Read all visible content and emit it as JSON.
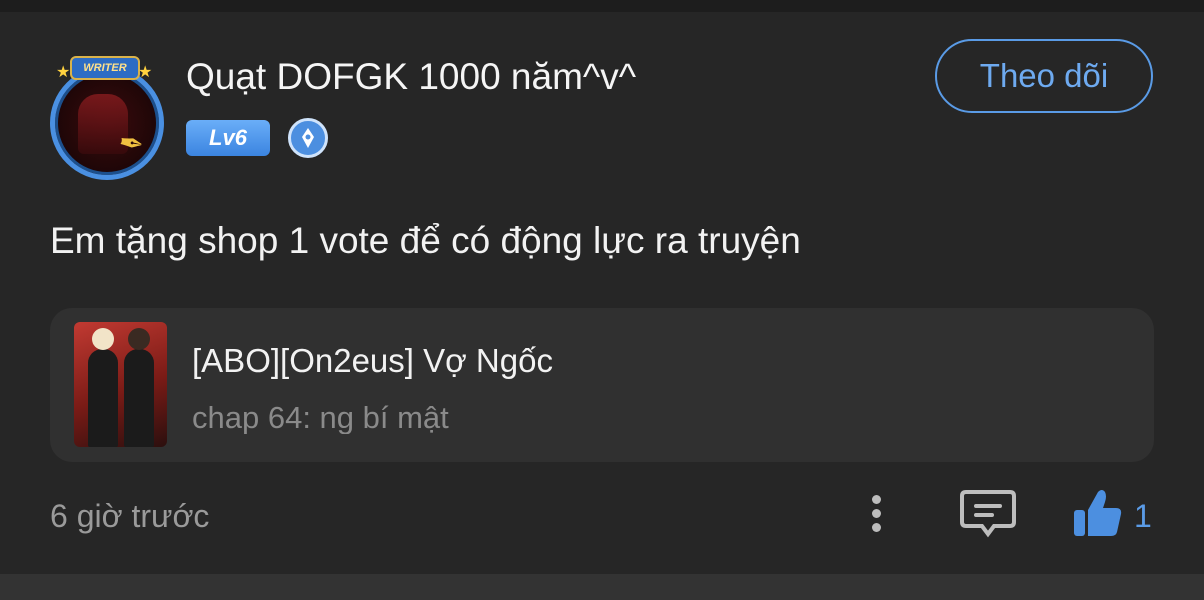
{
  "post": {
    "author": {
      "name": "Quạt DOFGK 1000 năm^v^",
      "avatar_frame_label": "WRITER",
      "level": "Lv6",
      "badge_icon": "author-pen-icon"
    },
    "follow_label": "Theo dõi",
    "text": "Em tặng shop 1 vote để có động lực ra truyện",
    "story": {
      "title": "[ABO][On2eus] Vợ Ngốc",
      "chapter": "chap 64: ng bí mật",
      "cover_icon": "story-cover-image"
    },
    "timestamp": "6 giờ trước",
    "actions": {
      "more_icon": "more-vertical-icon",
      "comment_icon": "comment-icon",
      "like_icon": "thumbs-up-icon",
      "like_count": "1"
    }
  },
  "colors": {
    "accent": "#5a9be6",
    "background": "#262626",
    "card": "#303030"
  }
}
